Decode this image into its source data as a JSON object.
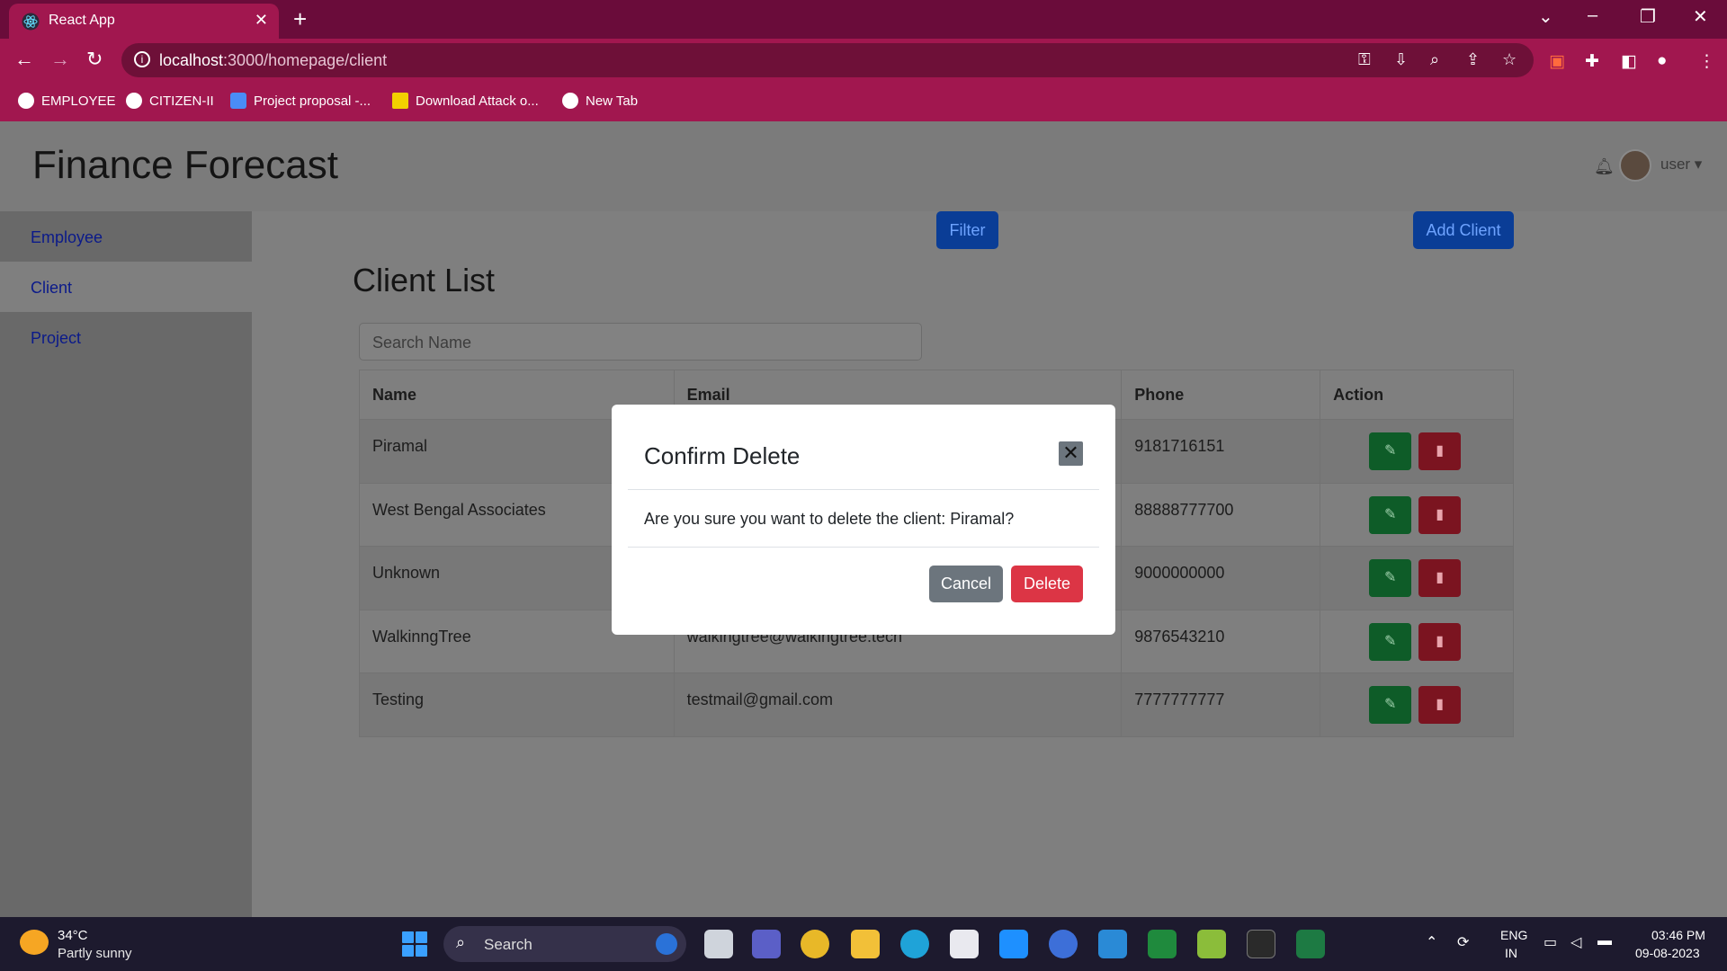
{
  "browser": {
    "tab_title": "React App",
    "tab_close": "✕",
    "new_tab": "+",
    "url_host": "localhost",
    "url_path": ":3000/homepage/client",
    "window_controls": [
      "⌄",
      "–",
      "❐",
      "✕"
    ],
    "bookmarks": [
      {
        "label": "EMPLOYEE",
        "icon": "globe-icon"
      },
      {
        "label": "CITIZEN-II",
        "icon": "globe-icon"
      },
      {
        "label": "Project proposal -...",
        "icon": "docs-icon"
      },
      {
        "label": "Download Attack o...",
        "icon": "ys-icon"
      },
      {
        "label": "New Tab",
        "icon": "globe-icon"
      }
    ]
  },
  "app": {
    "brand": "Finance Forecast",
    "user": "user ▾",
    "sidebar": [
      "Employee",
      "Client",
      "Project"
    ],
    "active_sidebar": "Client"
  },
  "page": {
    "title": "Client List",
    "search_placeholder": "Search Name",
    "filter_label": "Filter",
    "add_label": "Add Client"
  },
  "table": {
    "headers": [
      "Name",
      "Email",
      "Phone",
      "Action"
    ],
    "rows": [
      {
        "name": "Piramal",
        "email": "",
        "phone": "9181716151"
      },
      {
        "name": "West Bengal Associates",
        "email": "",
        "phone": "88888777700"
      },
      {
        "name": "Unknown",
        "email": "",
        "phone": "9000000000"
      },
      {
        "name": "WalkinngTree",
        "email": "walkingtree@walkingtree.tech",
        "phone": "9876543210"
      },
      {
        "name": "Testing",
        "email": "testmail@gmail.com",
        "phone": "7777777777"
      }
    ]
  },
  "modal": {
    "title": "Confirm Delete",
    "close": "✕",
    "body": "Are you sure you want to delete the client: Piramal?",
    "cancel_label": "Cancel",
    "delete_label": "Delete"
  },
  "taskbar": {
    "temperature": "34°C",
    "weather": "Partly sunny",
    "search_label": "Search",
    "lang_line1": "ENG",
    "lang_line2": "IN",
    "time": "03:46 PM",
    "date": "09-08-2023"
  },
  "colors": {
    "chrome_accent": "#a1174f",
    "primary_button": "#0a3d96",
    "edit_button": "#0e5c28",
    "delete_button": "#7b1420",
    "modal_delete": "#dc3545",
    "modal_cancel": "#6c757d"
  }
}
